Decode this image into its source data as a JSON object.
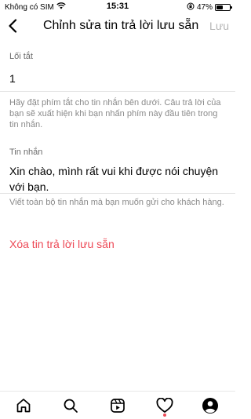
{
  "status_bar": {
    "carrier": "Không có SIM",
    "time": "15:31",
    "battery_percent": "47%",
    "battery_level": 0.47
  },
  "header": {
    "title": "Chỉnh sửa tin trả lời lưu sẵn",
    "save_label": "Lưu"
  },
  "shortcut": {
    "label": "Lối tắt",
    "value": "1",
    "help": "Hãy đặt phím tắt cho tin nhắn bên dưới. Câu trả lời của bạn sẽ xuất hiện khi bạn nhấn phím này đầu tiên trong tin nhắn."
  },
  "message": {
    "label": "Tin nhắn",
    "value": "Xin chào, mình rất vui khi được nói chuyện với bạn.",
    "help": "Viết toàn bộ tin nhắn mà bạn muốn gửi cho khách hàng."
  },
  "delete_label": "Xóa tin trả lời lưu sẵn",
  "nav": {
    "items": [
      "home-icon",
      "search-icon",
      "reels-icon",
      "heart-icon",
      "profile-icon"
    ],
    "accent": "#ed4956"
  }
}
